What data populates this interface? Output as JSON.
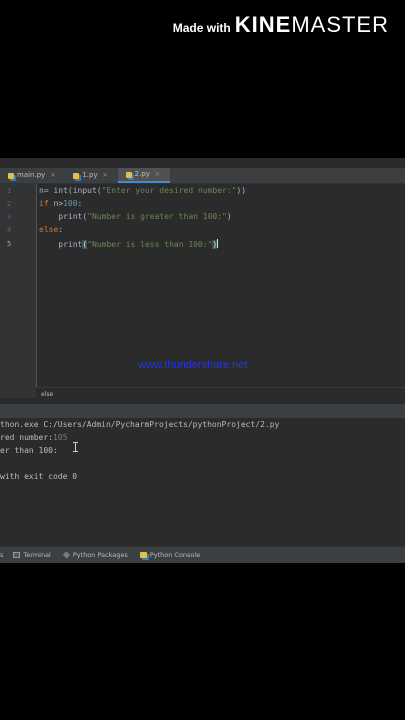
{
  "watermark": {
    "made_with": "Made with",
    "brand_bold": "KINE",
    "brand_light": "MASTER"
  },
  "tabs": [
    {
      "label": "main.py",
      "active": false
    },
    {
      "label": "1.py",
      "active": false
    },
    {
      "label": "2.py",
      "active": true
    }
  ],
  "editor": {
    "line_numbers": [
      "1",
      "2",
      "3",
      "4",
      "5"
    ],
    "current_line": "5",
    "lines": [
      {
        "a": "n= int(input(",
        "b": "\"Enter your desired number:\"",
        "c": "))"
      },
      {
        "a": "if",
        "b": " n>",
        "c": "100",
        "d": ":"
      },
      {
        "a": "    print(",
        "b": "\"Number is greater than 100:\"",
        "c": ")"
      },
      {
        "a": "else",
        "b": ":"
      },
      {
        "a": "    print",
        "b": "(",
        "c": "\"Number is less than 100:\"",
        "d": ")"
      }
    ],
    "website": "www.thundershare.net",
    "breadcrumb": "else"
  },
  "console": {
    "lines": [
      "thon.exe C:/Users/Admin/PycharmProjects/pythonProject/2.py",
      {
        "text": "red number:",
        "input": "105"
      },
      "er than 100:",
      "",
      "with exit code 0"
    ]
  },
  "statusbar": {
    "first": "s",
    "items": [
      {
        "label": "Terminal",
        "icon": "terminal-icon"
      },
      {
        "label": "Python Packages",
        "icon": "packages-icon"
      },
      {
        "label": "Python Console",
        "icon": "python-console-icon"
      }
    ]
  },
  "colors": {
    "keyword": "#cc7832",
    "string": "#6a8759",
    "number": "#6897bb",
    "link": "#2836d6"
  }
}
